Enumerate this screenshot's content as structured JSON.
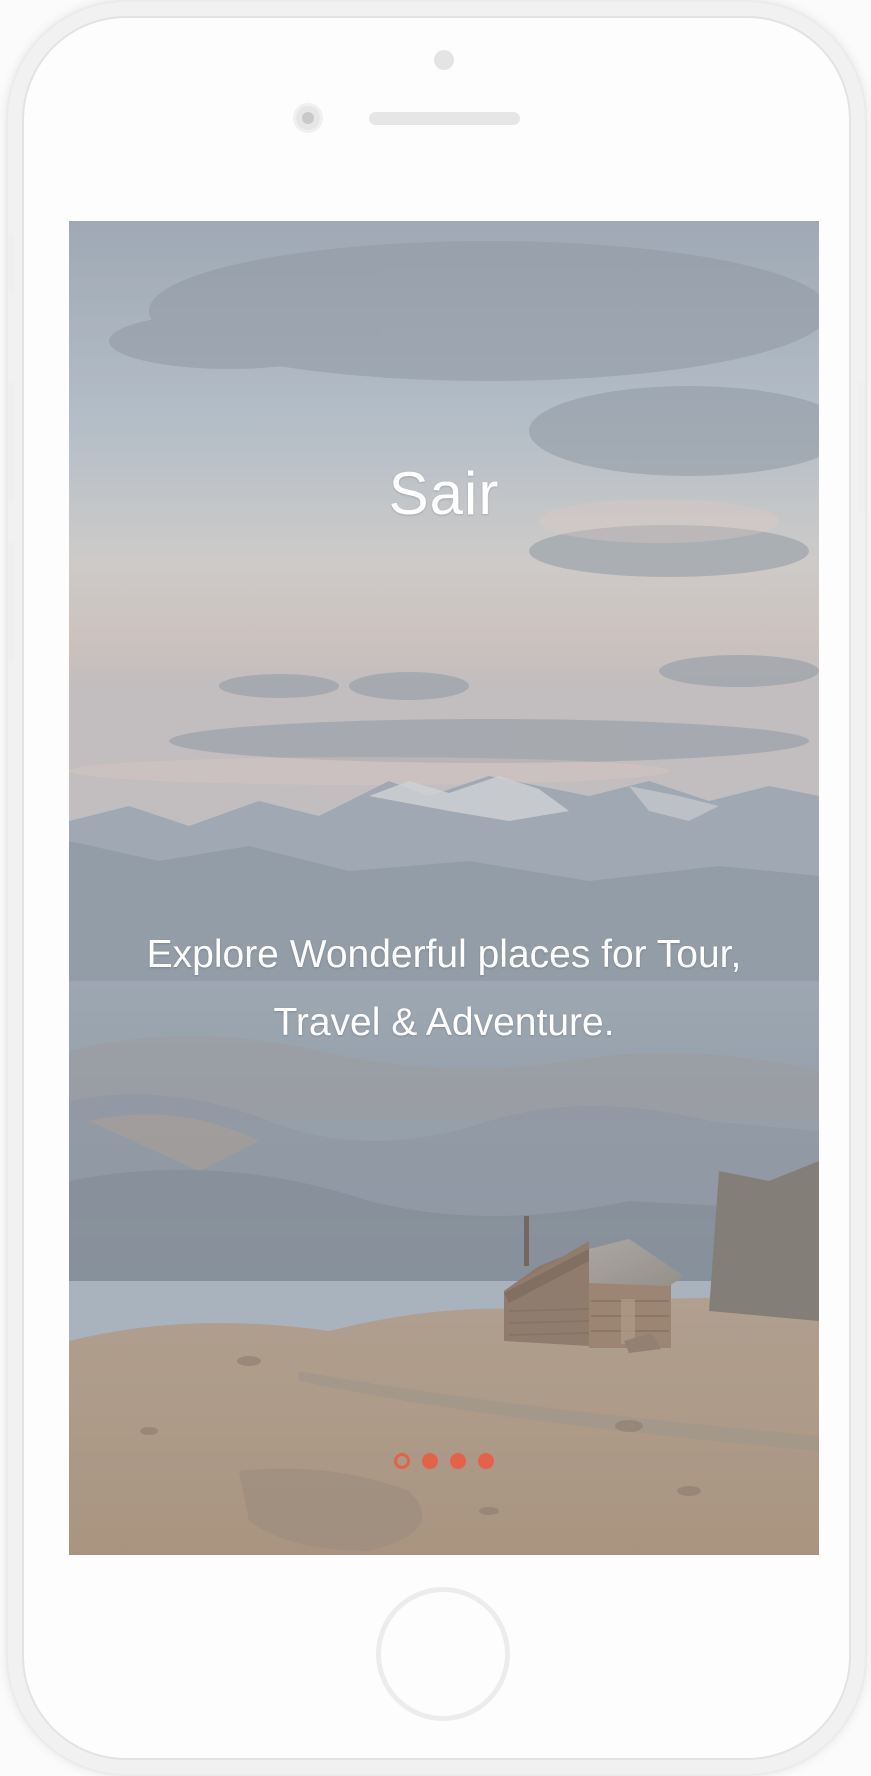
{
  "app": {
    "title": "Sair",
    "tagline": "Explore Wonderful places for Tour, Travel & Adventure."
  },
  "pager": {
    "total_pages": 4,
    "current_page": 1
  },
  "colors": {
    "accent": "#e4624a",
    "text": "#ffffff"
  },
  "icons": {
    "home_button": "home-button-icon",
    "front_camera": "front-camera-icon"
  }
}
